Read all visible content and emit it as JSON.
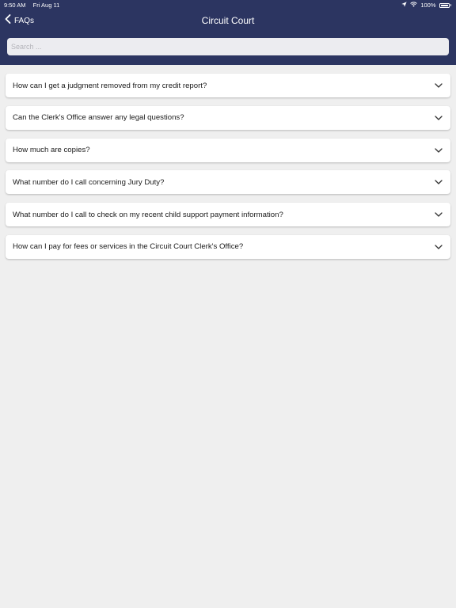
{
  "status_bar": {
    "time": "9:50 AM",
    "date": "Fri Aug 11",
    "battery": "100%",
    "icons": [
      "location-arrow-icon",
      "wifi-icon",
      "battery-icon"
    ]
  },
  "nav": {
    "back_label": "FAQs",
    "title": "Circuit Court"
  },
  "search": {
    "placeholder": "Search ...",
    "value": ""
  },
  "faqs": [
    {
      "question": "How can I get a judgment removed from my credit report?"
    },
    {
      "question": "Can the Clerk's Office answer any legal questions?"
    },
    {
      "question": "How much are copies?"
    },
    {
      "question": "What number do I call concerning Jury Duty?"
    },
    {
      "question": "What number do I call to check on my recent child support payment information?"
    },
    {
      "question": "How can I pay for fees or services in the Circuit Court Clerk's Office?"
    }
  ],
  "colors": {
    "header_bg": "#2c3561",
    "page_bg": "#efefef",
    "card_bg": "#ffffff"
  }
}
